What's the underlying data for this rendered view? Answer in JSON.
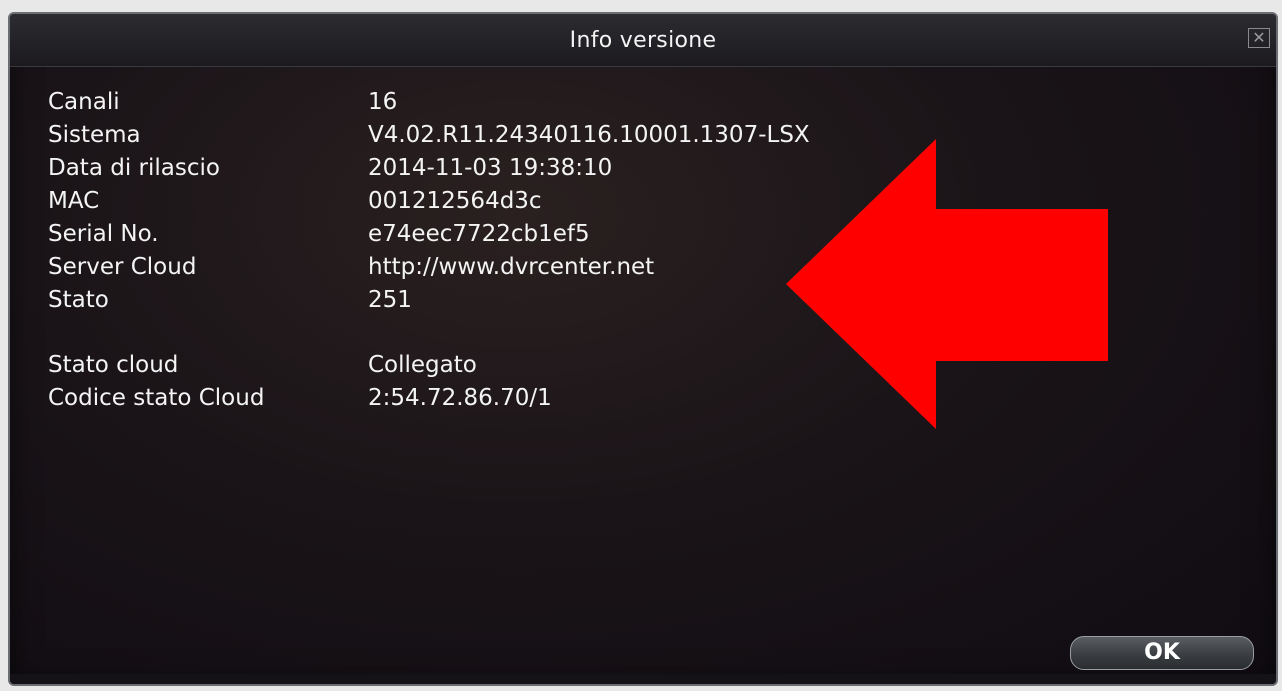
{
  "dialog": {
    "title": "Info versione",
    "close_icon": "close-icon",
    "ok_label": "OK"
  },
  "rows": [
    {
      "label": "Canali",
      "value": "16"
    },
    {
      "label": "Sistema",
      "value": "V4.02.R11.24340116.10001.1307-LSX"
    },
    {
      "label": "Data di rilascio",
      "value": "2014-11-03 19:38:10"
    },
    {
      "label": "MAC",
      "value": "001212564d3c"
    },
    {
      "label": "Serial No.",
      "value": "e74eec7722cb1ef5"
    },
    {
      "label": "Server Cloud",
      "value": "http://www.dvrcenter.net"
    },
    {
      "label": "Stato",
      "value": "251"
    }
  ],
  "cloud_rows": [
    {
      "label": "Stato cloud",
      "value": "Collegato"
    },
    {
      "label": "Codice stato Cloud",
      "value": "2:54.72.86.70/1"
    }
  ],
  "colors": {
    "arrow": "#ff0000",
    "background": "#140f14",
    "text": "#f4f4f4"
  }
}
